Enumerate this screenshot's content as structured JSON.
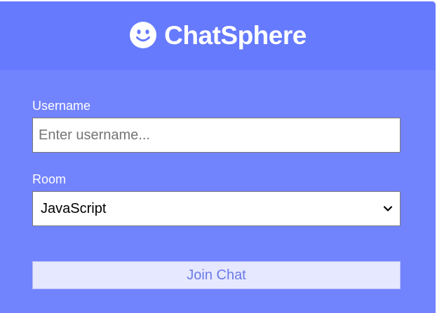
{
  "app": {
    "title": "ChatSphere",
    "logo_icon": "smiley-icon"
  },
  "form": {
    "username": {
      "label": "Username",
      "placeholder": "Enter username...",
      "value": ""
    },
    "room": {
      "label": "Room",
      "selected": "JavaScript"
    },
    "submit_label": "Join Chat"
  },
  "colors": {
    "header_bg": "#667afe",
    "card_bg": "#7283fe",
    "button_bg": "#e6e8ff",
    "button_text": "#6b7ae8",
    "text_light": "#ffffff"
  }
}
